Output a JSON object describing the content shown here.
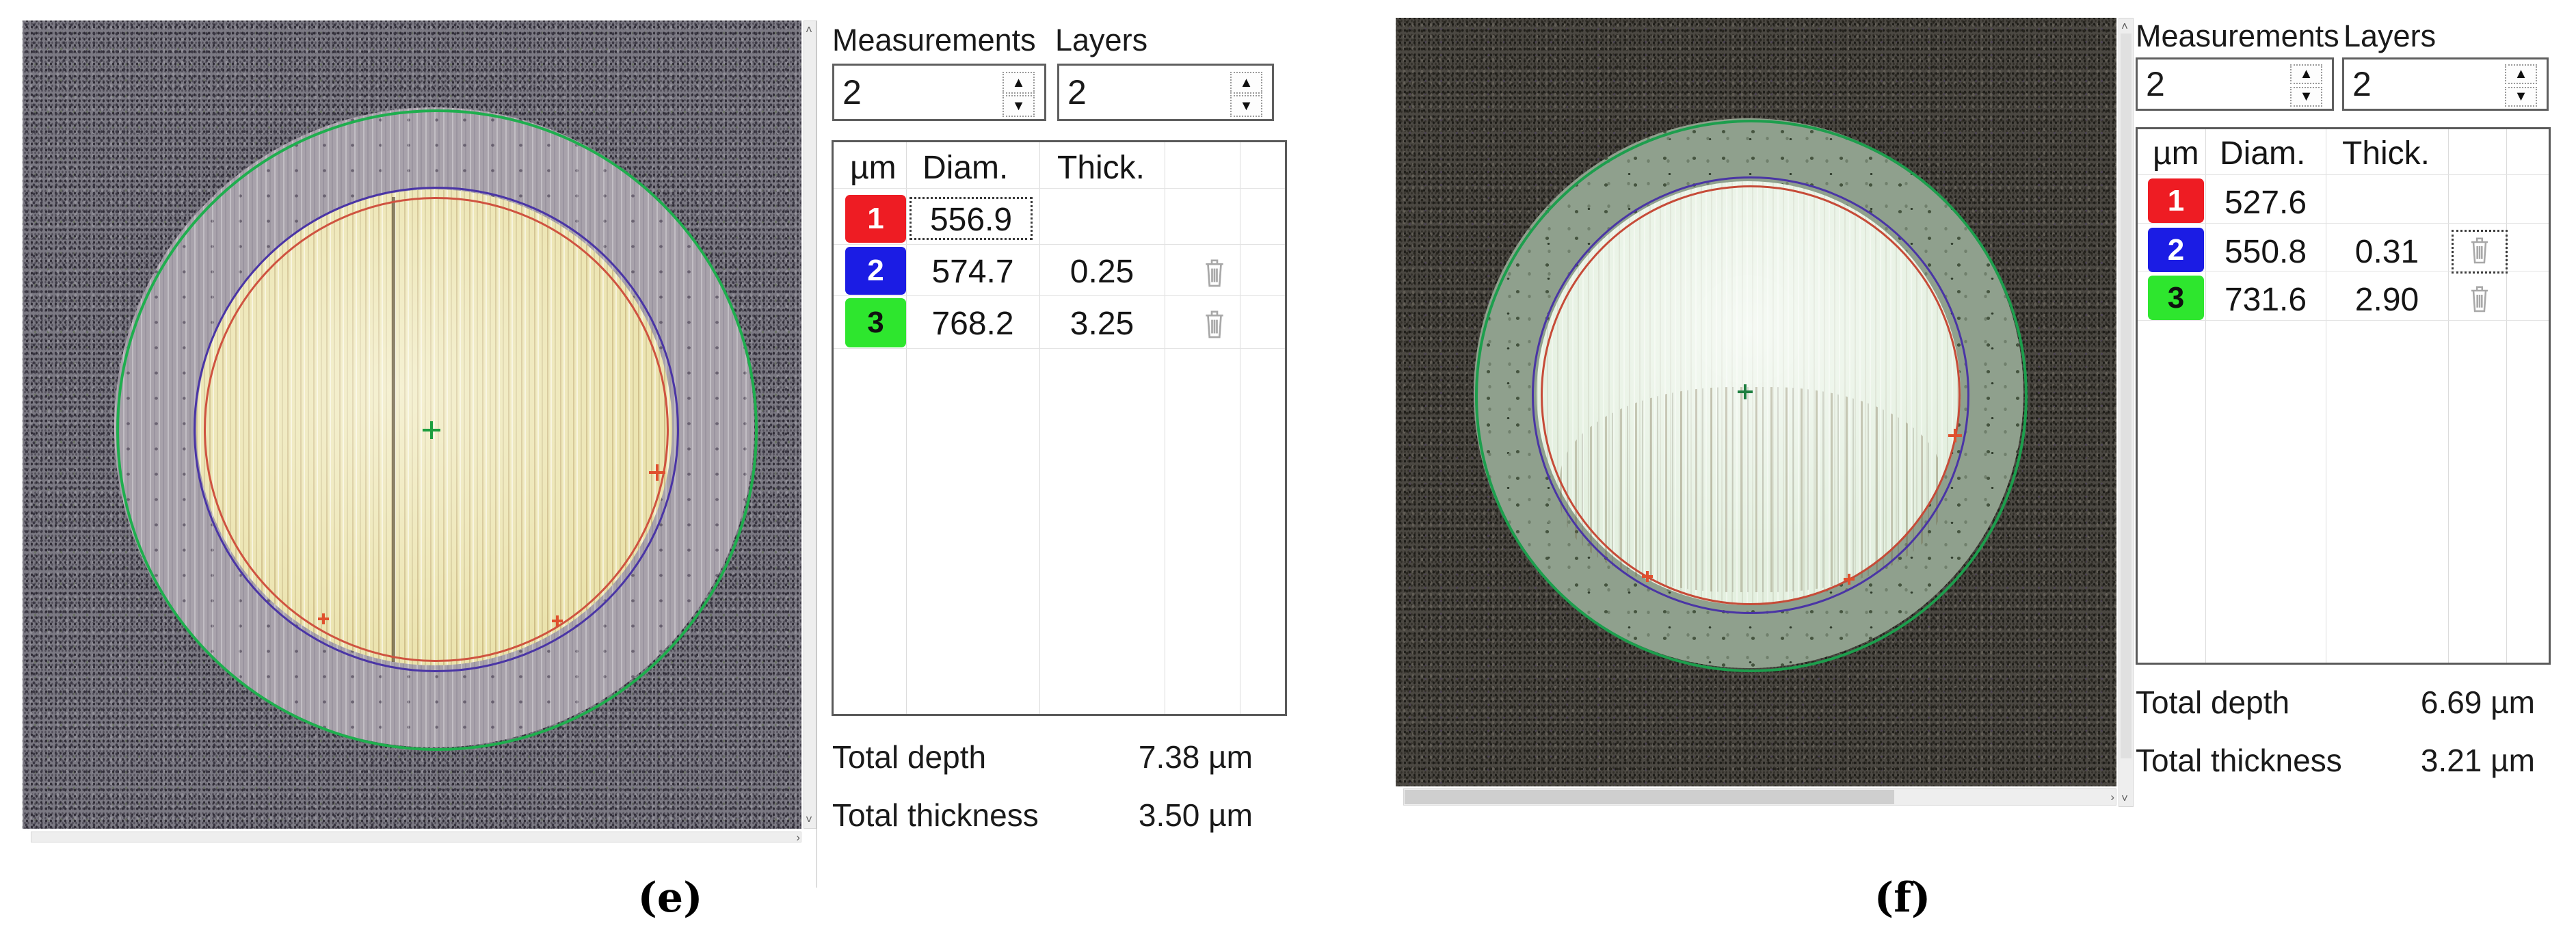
{
  "panels": [
    {
      "caption": "(e)",
      "controls": {
        "measurements_label": "Measurements",
        "measurements_value": "2",
        "layers_label": "Layers",
        "layers_value": "2"
      },
      "table": {
        "headers": {
          "unit": "µm",
          "diam": "Diam.",
          "thick": "Thick."
        },
        "rows": [
          {
            "index": "1",
            "color": "#ee1c23",
            "diam": "556.9",
            "thick": "",
            "selected": "diam"
          },
          {
            "index": "2",
            "color": "#1b1ce4",
            "diam": "574.7",
            "thick": "0.25"
          },
          {
            "index": "3",
            "color": "#2ee62e",
            "diam": "768.2",
            "thick": "3.25"
          }
        ]
      },
      "totals": {
        "depth_label": "Total depth",
        "depth_value": "7.38 µm",
        "thickness_label": "Total thickness",
        "thickness_value": "3.50 µm"
      }
    },
    {
      "caption": "(f)",
      "controls": {
        "measurements_label": "Measurements",
        "measurements_value": "2",
        "layers_label": "Layers",
        "layers_value": "2"
      },
      "table": {
        "headers": {
          "unit": "µm",
          "diam": "Diam.",
          "thick": "Thick."
        },
        "rows": [
          {
            "index": "1",
            "color": "#ee1c23",
            "diam": "527.6",
            "thick": ""
          },
          {
            "index": "2",
            "color": "#1b1ce4",
            "diam": "550.8",
            "thick": "0.31",
            "selected": "trash"
          },
          {
            "index": "3",
            "color": "#2ee62e",
            "diam": "731.6",
            "thick": "2.90"
          }
        ]
      },
      "totals": {
        "depth_label": "Total depth",
        "depth_value": "6.69 µm",
        "thickness_label": "Total thickness",
        "thickness_value": "3.21 µm"
      }
    }
  ],
  "annotation_colors": {
    "outer_circle": "#1fae4e",
    "middle_circle": "#4a35a5",
    "inner_circle": "#cf5340"
  }
}
